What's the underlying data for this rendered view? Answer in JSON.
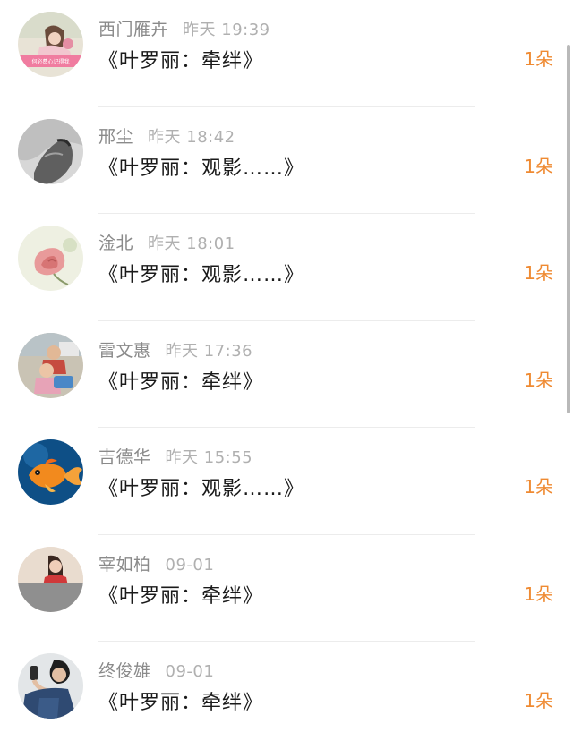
{
  "items": [
    {
      "name": "西门雁卉",
      "time": "昨天 19:39",
      "title": "《叶罗丽：牵绊》",
      "count": "1朵",
      "avatar_text": "何必费心记得我",
      "avatar_icon": "girl-with-flower-avatar-icon"
    },
    {
      "name": "邢尘",
      "time": "昨天 18:42",
      "title": "《叶罗丽：观影……》",
      "count": "1朵",
      "avatar_icon": "bw-portrait-avatar-icon"
    },
    {
      "name": "淦北",
      "time": "昨天 18:01",
      "title": "《叶罗丽：观影……》",
      "count": "1朵",
      "avatar_icon": "pink-rose-avatar-icon"
    },
    {
      "name": "雷文惠",
      "time": "昨天 17:36",
      "title": "《叶罗丽：牵绊》",
      "count": "1朵",
      "avatar_icon": "children-avatar-icon"
    },
    {
      "name": "吉德华",
      "time": "昨天 15:55",
      "title": "《叶罗丽：观影……》",
      "count": "1朵",
      "avatar_icon": "goldfish-avatar-icon"
    },
    {
      "name": "宰如柏",
      "time": "09-01",
      "title": "《叶罗丽：牵绊》",
      "count": "1朵",
      "avatar_icon": "woman-portrait-avatar-icon"
    },
    {
      "name": "终俊雄",
      "time": "09-01",
      "title": "《叶罗丽：牵绊》",
      "count": "1朵",
      "avatar_icon": "man-phone-avatar-icon"
    }
  ],
  "colors": {
    "name": "#8a8a8a",
    "time": "#b0b0b0",
    "title": "#1a1a1a",
    "count": "#ef8a32",
    "divider": "#ececec"
  }
}
